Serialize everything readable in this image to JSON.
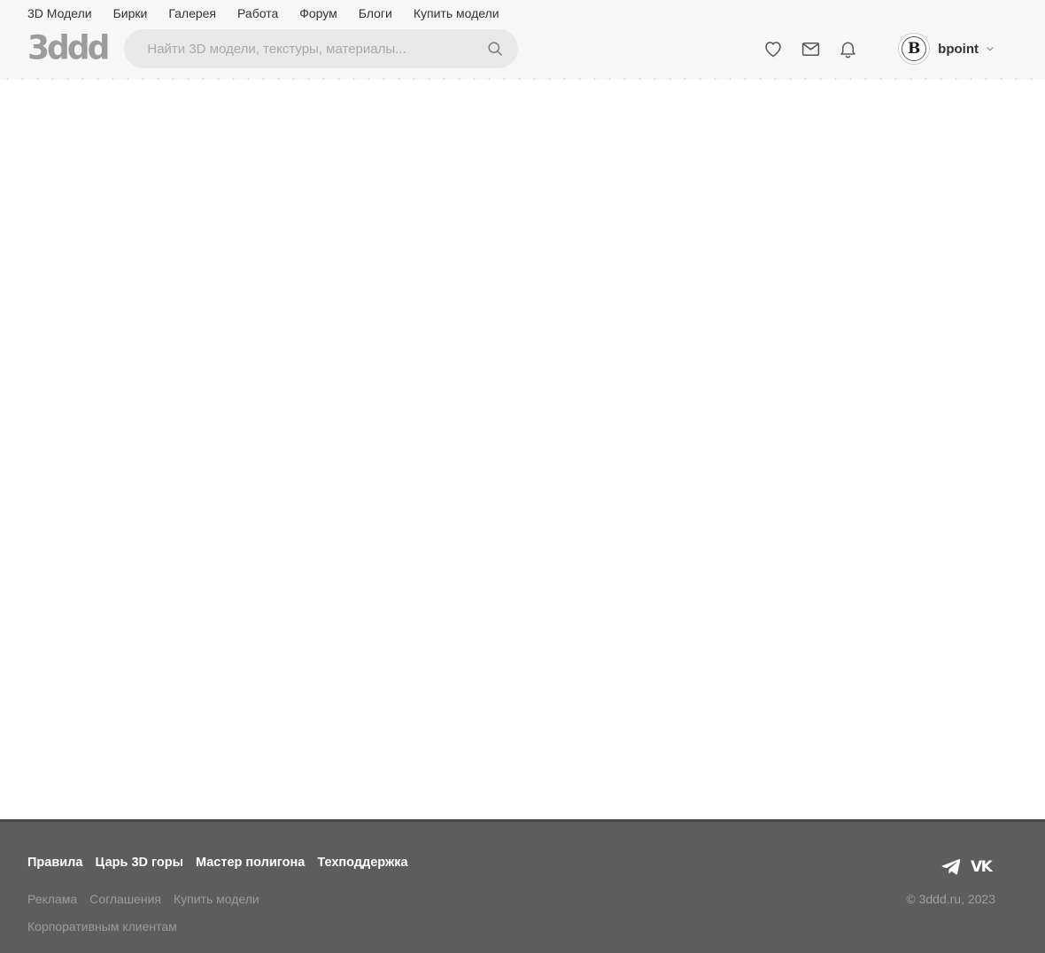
{
  "nav": {
    "items": [
      "3D Модели",
      "Бирки",
      "Галерея",
      "Работа",
      "Форум",
      "Блоги",
      "Купить модели"
    ]
  },
  "header": {
    "logo_text": "3ddd",
    "search": {
      "placeholder": "Найти 3D модели, текстуры, материалы...",
      "value": ""
    },
    "icons": [
      "heart-icon",
      "mail-icon",
      "bell-icon",
      "search-icon"
    ],
    "user": {
      "name": "bpoint",
      "avatar_letter": "B"
    }
  },
  "footer": {
    "primary_links": [
      "Правила",
      "Царь 3D горы",
      "Мастер полигона",
      "Техподдержка"
    ],
    "secondary_links": [
      "Реклама",
      "Соглашения",
      "Купить модели"
    ],
    "tertiary_links": [
      "Корпоративным клиентам"
    ],
    "social_icons": [
      "telegram-icon",
      "vk-icon"
    ],
    "copyright": "© 3ddd.ru, 2023"
  },
  "colors": {
    "header_bg": "#f7f7f7",
    "search_bg": "#e9e9e9",
    "logo_gray": "#9c9c9c",
    "footer_bg": "#5d5d5d",
    "footer_border": "#474747",
    "footer_link_white": "#ffffff",
    "footer_link_gray": "#9b9b9b"
  }
}
